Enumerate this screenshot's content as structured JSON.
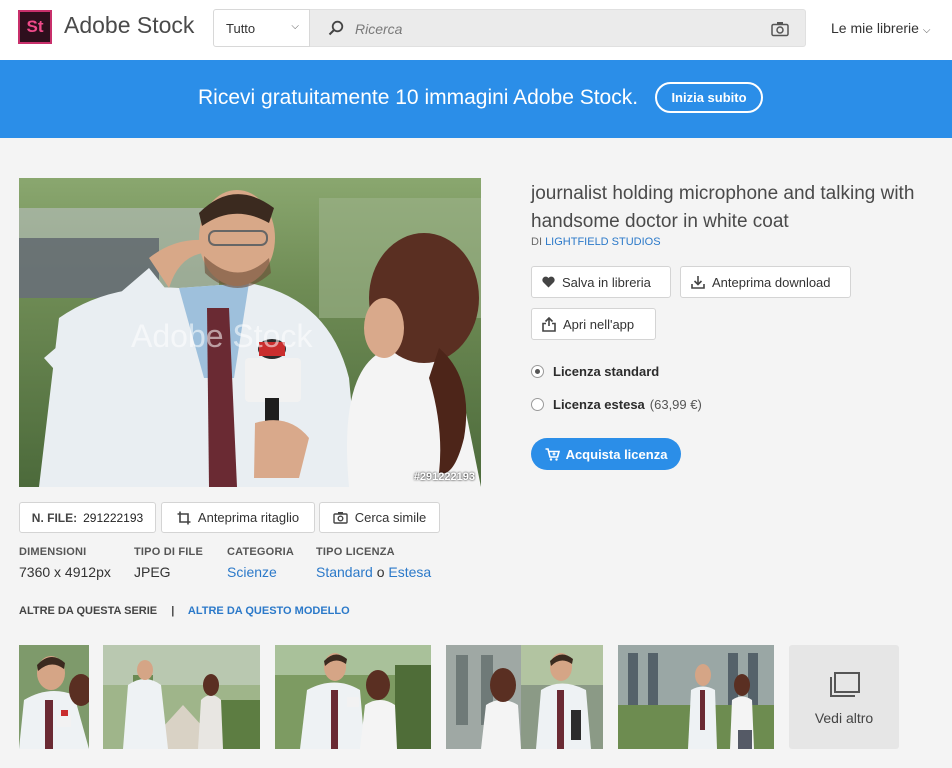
{
  "header": {
    "logo_text": "St",
    "brand": "Adobe Stock",
    "filter": "Tutto",
    "search_placeholder": "Ricerca",
    "my_libraries": "Le mie librerie"
  },
  "banner": {
    "text": "Ricevi gratuitamente 10 immagini Adobe Stock.",
    "button": "Inizia subito"
  },
  "image": {
    "file_tag": "#291222193",
    "watermark": "Adobe Stock"
  },
  "asset": {
    "title": "journalist holding microphone and talking with handsome doctor in white coat",
    "by_prefix": "DI",
    "author": "LIGHTFIELD STUDIOS"
  },
  "actions": {
    "save": "Salva in libreria",
    "preview_download": "Anteprima download",
    "open_app": "Apri nell'app"
  },
  "license": {
    "standard": "Licenza standard",
    "extended": "Licenza estesa",
    "extended_price": "(63,99 €)",
    "buy": "Acquista licenza"
  },
  "file_info": {
    "file_label": "N. FILE:",
    "file_number": "291222193",
    "crop_preview": "Anteprima ritaglio",
    "find_similar": "Cerca simile"
  },
  "meta": {
    "dimensions_label": "DIMENSIONI",
    "dimensions": "7360 x 4912px",
    "type_label": "TIPO DI FILE",
    "type": "JPEG",
    "category_label": "CATEGORIA",
    "category": "Scienze",
    "license_label": "TIPO LICENZA",
    "license_standard": "Standard",
    "license_or": "o",
    "license_extended": "Estesa"
  },
  "series": {
    "same_series": "ALTRE DA QUESTA SERIE",
    "same_model": "ALTRE DA QUESTO MODELLO"
  },
  "see_more": "Vedi altro",
  "colors": {
    "accent_blue": "#2b8ee8",
    "link_blue": "#2b79c9",
    "logo_bg": "#2e0f1d",
    "logo_pink": "#f04a8a"
  }
}
